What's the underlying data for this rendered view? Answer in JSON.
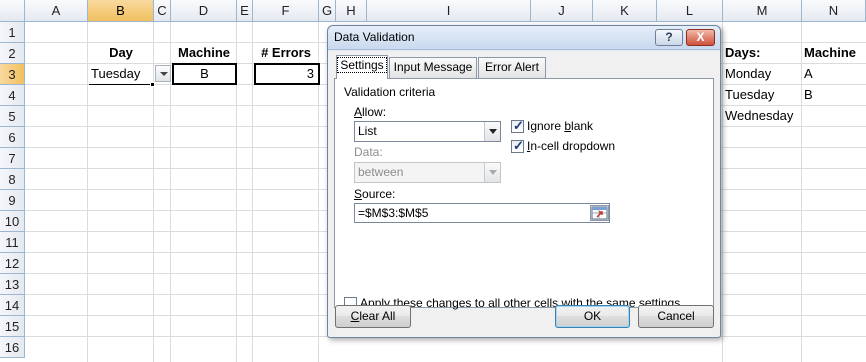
{
  "sheet": {
    "columns": [
      "A",
      "B",
      "C",
      "D",
      "E",
      "F",
      "G",
      "H",
      "I",
      "J",
      "K",
      "L",
      "M",
      "N"
    ],
    "rows": [
      "1",
      "2",
      "3",
      "4",
      "5",
      "6",
      "7",
      "8",
      "9",
      "10",
      "11",
      "12",
      "13",
      "14",
      "15",
      "16"
    ],
    "headers": {
      "day": "Day",
      "machine": "Machine",
      "errors": "# Errors"
    },
    "values": {
      "day": "Tuesday",
      "machine": "B",
      "errors": "3"
    },
    "list_days_header": "Days:",
    "list_machine_header": "Machine",
    "days": [
      "Monday",
      "Tuesday",
      "Wednesday"
    ],
    "machines": [
      "A",
      "B"
    ]
  },
  "dialog": {
    "title": "Data Validation",
    "help_button": "?",
    "close_button": "X",
    "tabs": [
      "Settings",
      "Input Message",
      "Error Alert"
    ],
    "section_title": "Validation criteria",
    "allow_label_u": "A",
    "allow_label_rest": "llow:",
    "allow_value": "List",
    "data_label": "Data:",
    "data_value": "between",
    "ignore_blank_pre": "Ignore ",
    "ignore_blank_u": "b",
    "ignore_blank_post": "lank",
    "in_cell_u": "I",
    "in_cell_rest": "n-cell dropdown",
    "source_label_u": "S",
    "source_label_rest": "ource:",
    "source_value": "=$M$3:$M$5",
    "apply_all_pre": "Ap",
    "apply_all_u": "p",
    "apply_all_post": "ly these changes to all other cells with the same settings",
    "clear_all_u": "C",
    "clear_all_rest": "lear All",
    "ok_label": "OK",
    "cancel_label": "Cancel"
  },
  "colors": {
    "selected_header": "#f1c15f",
    "dialog_frame": "#dfe8f4",
    "grid_line": "#dadcdd"
  }
}
